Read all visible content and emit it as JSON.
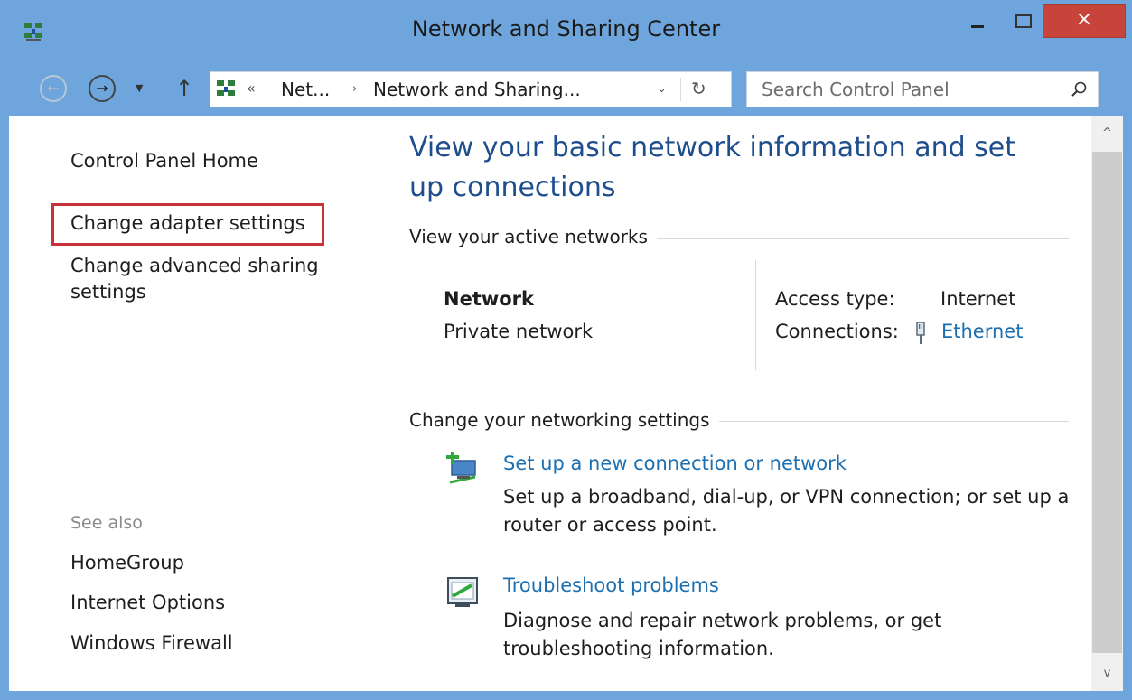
{
  "window": {
    "title": "Network and Sharing Center",
    "close_glyph": "×",
    "accent_color": "#6ea5dc",
    "close_color": "#c7443b"
  },
  "nav": {
    "back_glyph": "←",
    "forward_glyph": "→",
    "recent_glyph": "▼",
    "up_glyph": "↑",
    "address": {
      "chevrons": "«",
      "segment1": "Net...",
      "separator": "›",
      "segment2": "Network and Sharing...",
      "dropdown_glyph": "⌄",
      "refresh_glyph": "↻"
    },
    "search_placeholder": "Search Control Panel"
  },
  "sidebar": {
    "home": "Control Panel Home",
    "change_adapter": "Change adapter settings",
    "change_advanced_line1": "Change advanced sharing",
    "change_advanced_line2": "settings",
    "see_also": "See also",
    "homegroup": "HomeGroup",
    "internet_options": "Internet Options",
    "windows_firewall": "Windows Firewall"
  },
  "main": {
    "heading": "View your basic network information and set up connections",
    "active_networks_title": "View your active networks",
    "network_name": "Network",
    "network_type": "Private network",
    "access_type_label": "Access type:",
    "access_type_value": "Internet",
    "connections_label": "Connections:",
    "connections_value": "Ethernet",
    "change_settings_title": "Change your networking settings",
    "task1_link": "Set up a new connection or network",
    "task1_desc": "Set up a broadband, dial-up, or VPN connection; or set up a router or access point.",
    "task2_link": "Troubleshoot problems",
    "task2_desc": "Diagnose and repair network problems, or get troubleshooting information."
  },
  "scrollbar": {
    "up_glyph": "^",
    "down_glyph": "v"
  }
}
